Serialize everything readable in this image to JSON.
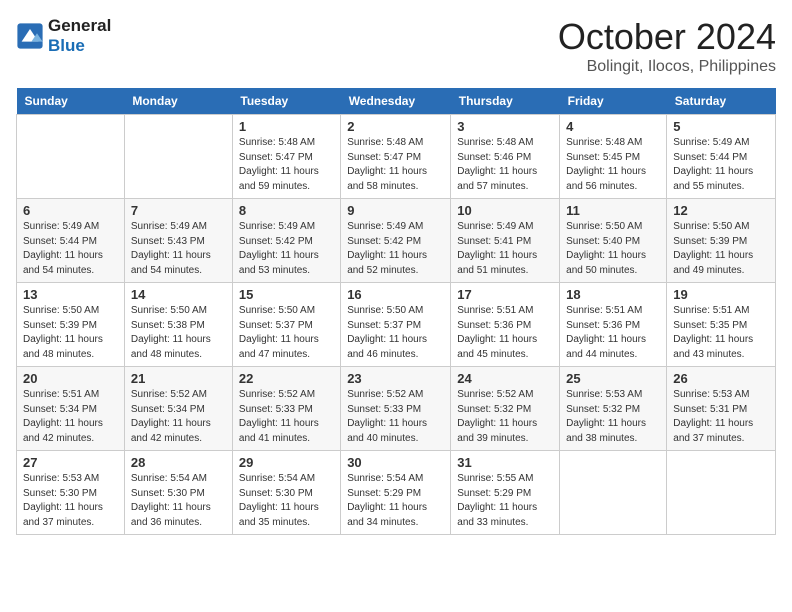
{
  "logo": {
    "line1": "General",
    "line2": "Blue"
  },
  "title": "October 2024",
  "subtitle": "Bolingit, Ilocos, Philippines",
  "weekdays": [
    "Sunday",
    "Monday",
    "Tuesday",
    "Wednesday",
    "Thursday",
    "Friday",
    "Saturday"
  ],
  "weeks": [
    [
      {
        "day": "",
        "info": ""
      },
      {
        "day": "",
        "info": ""
      },
      {
        "day": "1",
        "info": "Sunrise: 5:48 AM\nSunset: 5:47 PM\nDaylight: 11 hours\nand 59 minutes."
      },
      {
        "day": "2",
        "info": "Sunrise: 5:48 AM\nSunset: 5:47 PM\nDaylight: 11 hours\nand 58 minutes."
      },
      {
        "day": "3",
        "info": "Sunrise: 5:48 AM\nSunset: 5:46 PM\nDaylight: 11 hours\nand 57 minutes."
      },
      {
        "day": "4",
        "info": "Sunrise: 5:48 AM\nSunset: 5:45 PM\nDaylight: 11 hours\nand 56 minutes."
      },
      {
        "day": "5",
        "info": "Sunrise: 5:49 AM\nSunset: 5:44 PM\nDaylight: 11 hours\nand 55 minutes."
      }
    ],
    [
      {
        "day": "6",
        "info": "Sunrise: 5:49 AM\nSunset: 5:44 PM\nDaylight: 11 hours\nand 54 minutes."
      },
      {
        "day": "7",
        "info": "Sunrise: 5:49 AM\nSunset: 5:43 PM\nDaylight: 11 hours\nand 54 minutes."
      },
      {
        "day": "8",
        "info": "Sunrise: 5:49 AM\nSunset: 5:42 PM\nDaylight: 11 hours\nand 53 minutes."
      },
      {
        "day": "9",
        "info": "Sunrise: 5:49 AM\nSunset: 5:42 PM\nDaylight: 11 hours\nand 52 minutes."
      },
      {
        "day": "10",
        "info": "Sunrise: 5:49 AM\nSunset: 5:41 PM\nDaylight: 11 hours\nand 51 minutes."
      },
      {
        "day": "11",
        "info": "Sunrise: 5:50 AM\nSunset: 5:40 PM\nDaylight: 11 hours\nand 50 minutes."
      },
      {
        "day": "12",
        "info": "Sunrise: 5:50 AM\nSunset: 5:39 PM\nDaylight: 11 hours\nand 49 minutes."
      }
    ],
    [
      {
        "day": "13",
        "info": "Sunrise: 5:50 AM\nSunset: 5:39 PM\nDaylight: 11 hours\nand 48 minutes."
      },
      {
        "day": "14",
        "info": "Sunrise: 5:50 AM\nSunset: 5:38 PM\nDaylight: 11 hours\nand 48 minutes."
      },
      {
        "day": "15",
        "info": "Sunrise: 5:50 AM\nSunset: 5:37 PM\nDaylight: 11 hours\nand 47 minutes."
      },
      {
        "day": "16",
        "info": "Sunrise: 5:50 AM\nSunset: 5:37 PM\nDaylight: 11 hours\nand 46 minutes."
      },
      {
        "day": "17",
        "info": "Sunrise: 5:51 AM\nSunset: 5:36 PM\nDaylight: 11 hours\nand 45 minutes."
      },
      {
        "day": "18",
        "info": "Sunrise: 5:51 AM\nSunset: 5:36 PM\nDaylight: 11 hours\nand 44 minutes."
      },
      {
        "day": "19",
        "info": "Sunrise: 5:51 AM\nSunset: 5:35 PM\nDaylight: 11 hours\nand 43 minutes."
      }
    ],
    [
      {
        "day": "20",
        "info": "Sunrise: 5:51 AM\nSunset: 5:34 PM\nDaylight: 11 hours\nand 42 minutes."
      },
      {
        "day": "21",
        "info": "Sunrise: 5:52 AM\nSunset: 5:34 PM\nDaylight: 11 hours\nand 42 minutes."
      },
      {
        "day": "22",
        "info": "Sunrise: 5:52 AM\nSunset: 5:33 PM\nDaylight: 11 hours\nand 41 minutes."
      },
      {
        "day": "23",
        "info": "Sunrise: 5:52 AM\nSunset: 5:33 PM\nDaylight: 11 hours\nand 40 minutes."
      },
      {
        "day": "24",
        "info": "Sunrise: 5:52 AM\nSunset: 5:32 PM\nDaylight: 11 hours\nand 39 minutes."
      },
      {
        "day": "25",
        "info": "Sunrise: 5:53 AM\nSunset: 5:32 PM\nDaylight: 11 hours\nand 38 minutes."
      },
      {
        "day": "26",
        "info": "Sunrise: 5:53 AM\nSunset: 5:31 PM\nDaylight: 11 hours\nand 37 minutes."
      }
    ],
    [
      {
        "day": "27",
        "info": "Sunrise: 5:53 AM\nSunset: 5:30 PM\nDaylight: 11 hours\nand 37 minutes."
      },
      {
        "day": "28",
        "info": "Sunrise: 5:54 AM\nSunset: 5:30 PM\nDaylight: 11 hours\nand 36 minutes."
      },
      {
        "day": "29",
        "info": "Sunrise: 5:54 AM\nSunset: 5:30 PM\nDaylight: 11 hours\nand 35 minutes."
      },
      {
        "day": "30",
        "info": "Sunrise: 5:54 AM\nSunset: 5:29 PM\nDaylight: 11 hours\nand 34 minutes."
      },
      {
        "day": "31",
        "info": "Sunrise: 5:55 AM\nSunset: 5:29 PM\nDaylight: 11 hours\nand 33 minutes."
      },
      {
        "day": "",
        "info": ""
      },
      {
        "day": "",
        "info": ""
      }
    ]
  ]
}
